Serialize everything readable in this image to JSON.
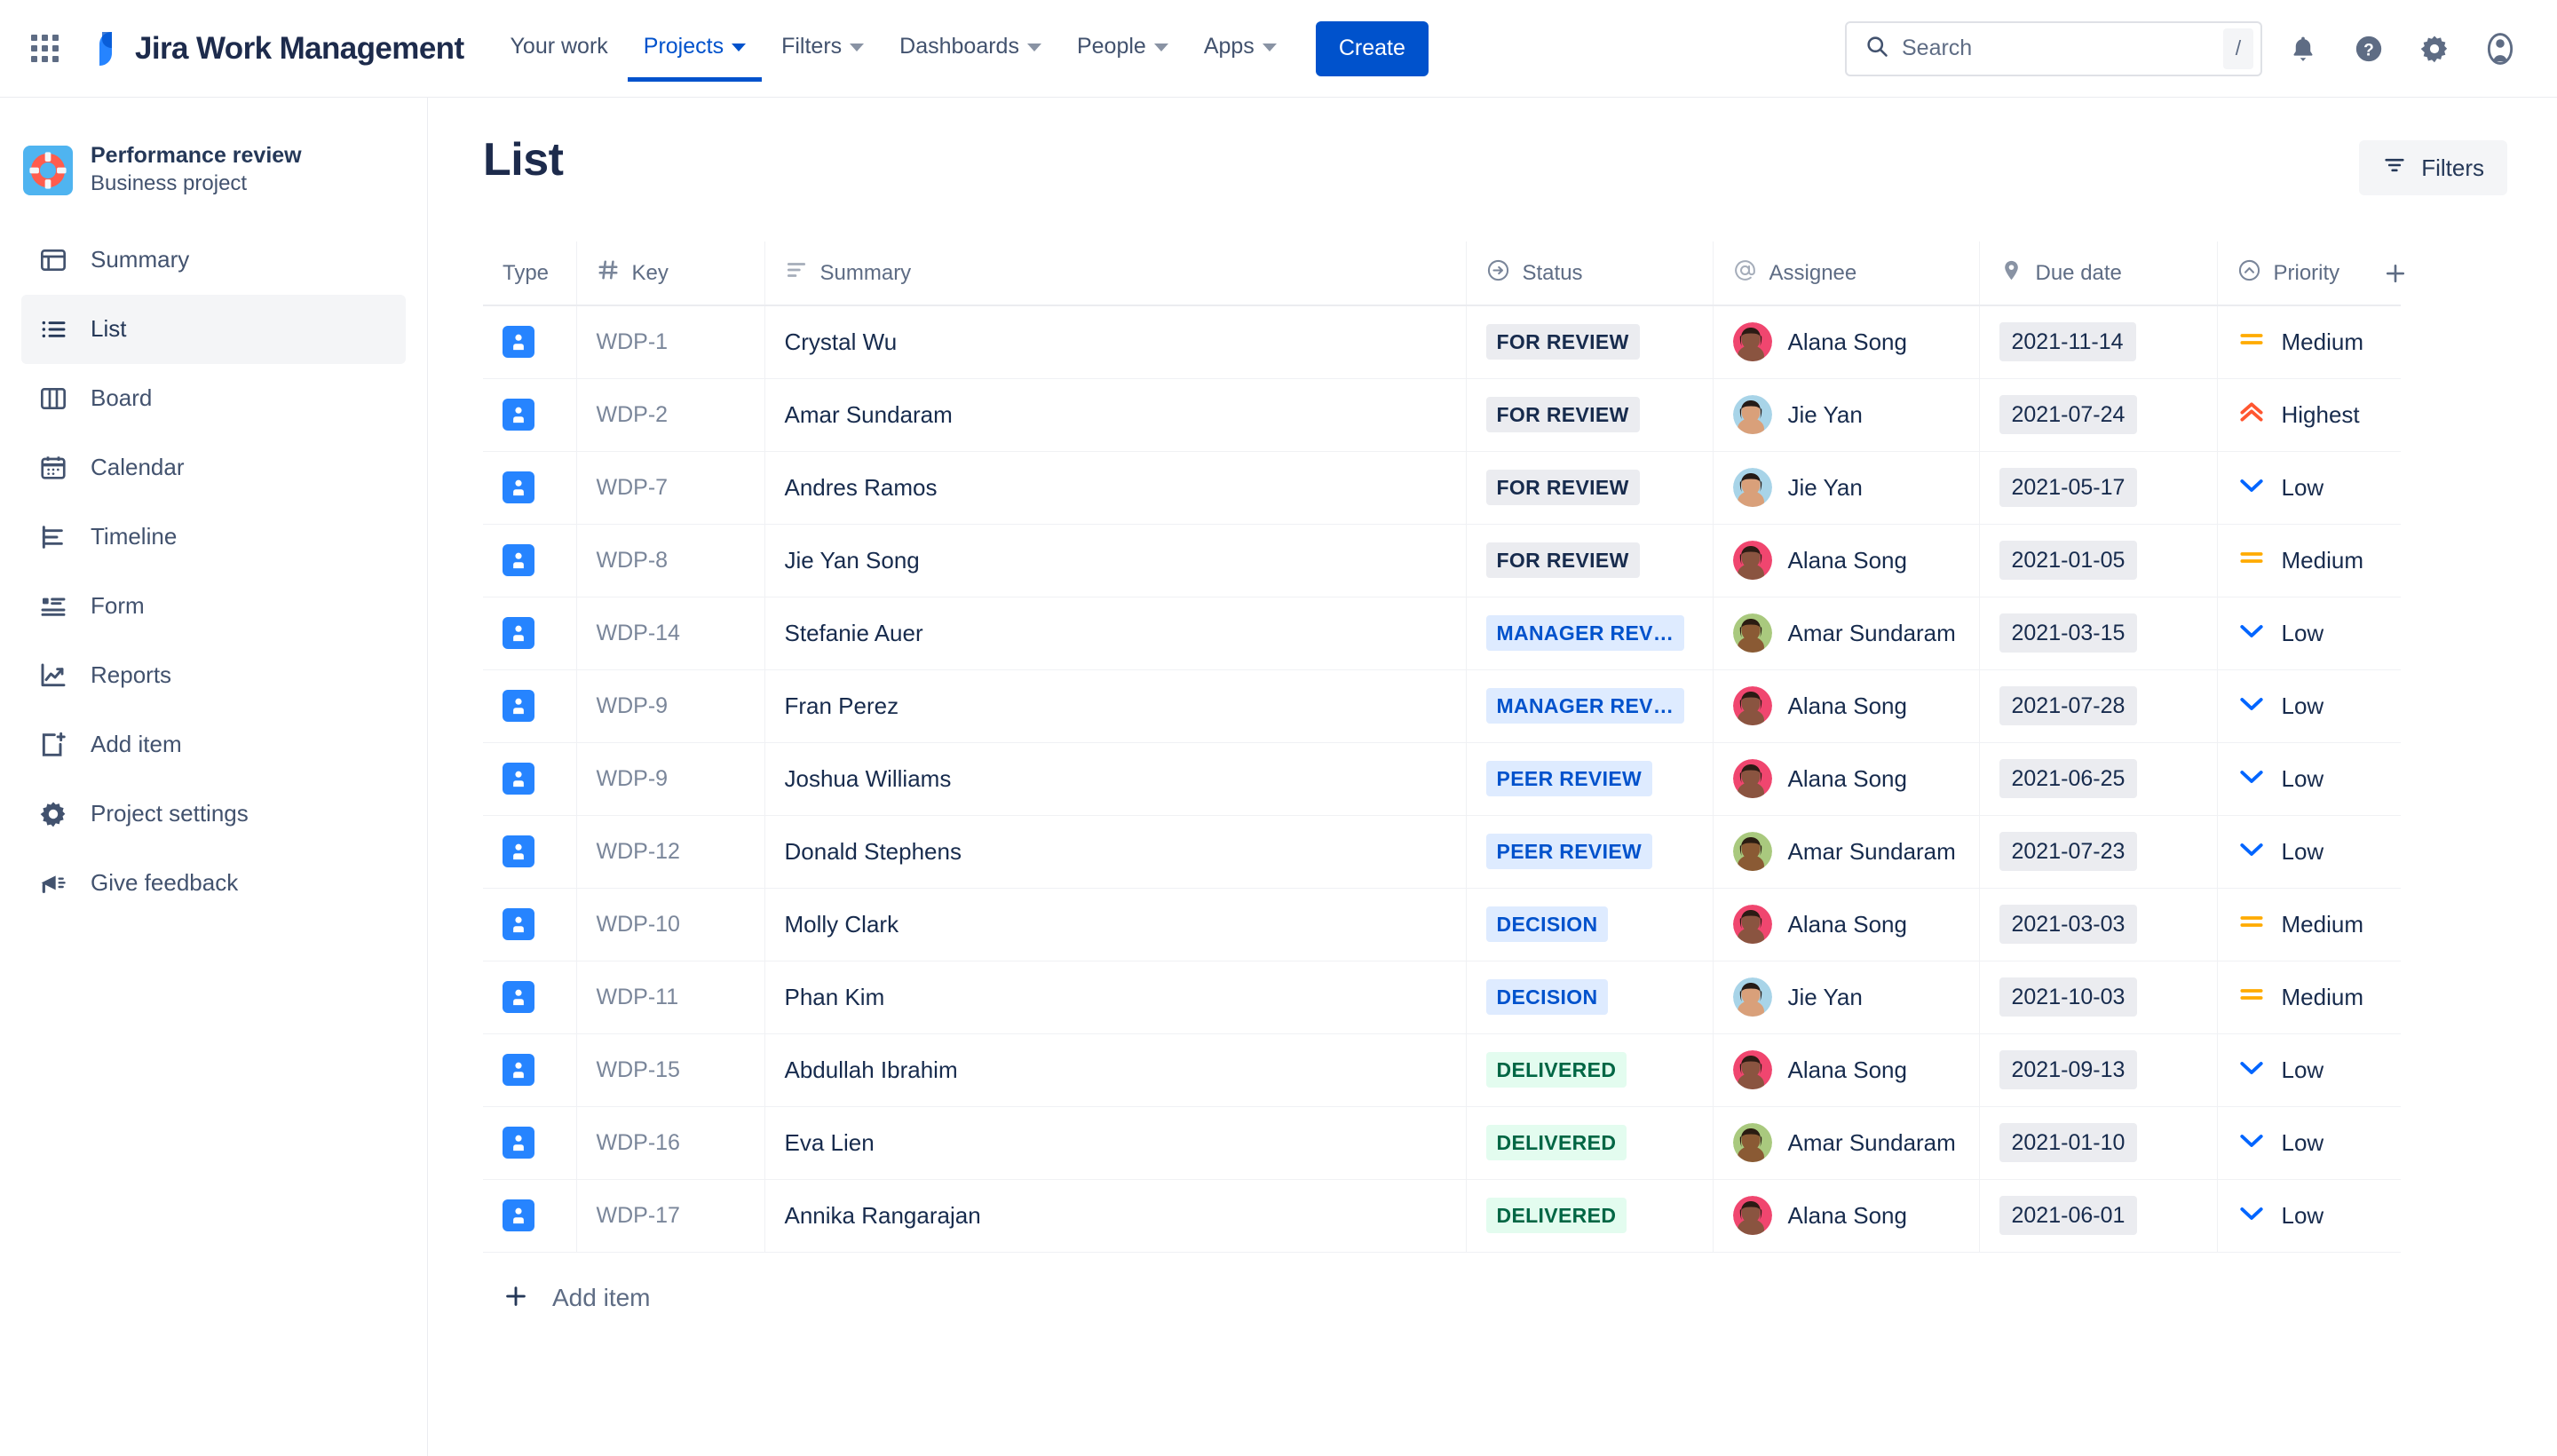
{
  "topnav": {
    "app_switcher_icon": "apps-grid-icon",
    "brand": "Jira Work Management",
    "items": [
      {
        "label": "Your work",
        "has_caret": false,
        "active": false
      },
      {
        "label": "Projects",
        "has_caret": true,
        "active": true
      },
      {
        "label": "Filters",
        "has_caret": true,
        "active": false
      },
      {
        "label": "Dashboards",
        "has_caret": true,
        "active": false
      },
      {
        "label": "People",
        "has_caret": true,
        "active": false
      },
      {
        "label": "Apps",
        "has_caret": true,
        "active": false
      }
    ],
    "create_label": "Create",
    "search": {
      "placeholder": "Search",
      "value": "",
      "shortcut": "/"
    },
    "icons": [
      "notifications-bell-icon",
      "help-icon",
      "settings-gear-icon",
      "user-profile-icon"
    ],
    "accent_color": "#0052CC"
  },
  "sidebar": {
    "project": {
      "name": "Performance review",
      "type": "Business project",
      "avatar_icon": "lifebuoy-icon",
      "avatar_color": "#4FB4F0"
    },
    "items": [
      {
        "label": "Summary",
        "icon": "summary-icon",
        "selected": false
      },
      {
        "label": "List",
        "icon": "list-icon",
        "selected": true
      },
      {
        "label": "Board",
        "icon": "board-icon",
        "selected": false
      },
      {
        "label": "Calendar",
        "icon": "calendar-icon",
        "selected": false
      },
      {
        "label": "Timeline",
        "icon": "timeline-icon",
        "selected": false
      },
      {
        "label": "Form",
        "icon": "form-icon",
        "selected": false
      },
      {
        "label": "Reports",
        "icon": "reports-icon",
        "selected": false
      },
      {
        "label": "Add item",
        "icon": "add-item-icon",
        "selected": false
      },
      {
        "label": "Project settings",
        "icon": "gear-icon",
        "selected": false
      },
      {
        "label": "Give feedback",
        "icon": "megaphone-icon",
        "selected": false
      }
    ]
  },
  "main": {
    "title": "List",
    "filters_button": {
      "label": "Filters",
      "icon": "filter-icon"
    },
    "add_item": {
      "label": "Add item",
      "icon": "plus-icon"
    },
    "add_column_icon": "plus-icon",
    "columns": [
      {
        "label": "Type",
        "icon": null
      },
      {
        "label": "Key",
        "icon": "hash-icon"
      },
      {
        "label": "Summary",
        "icon": "summary-lines-icon"
      },
      {
        "label": "Status",
        "icon": "status-arrow-icon"
      },
      {
        "label": "Assignee",
        "icon": "at-icon"
      },
      {
        "label": "Due date",
        "icon": "tag-icon"
      },
      {
        "label": "Priority",
        "icon": "priority-chevron-icon"
      }
    ],
    "rows": [
      {
        "type_icon": "person-task-icon",
        "key": "WDP-1",
        "summary": "Crystal Wu",
        "status": "FOR REVIEW",
        "status_tone": "gray",
        "assignee": "Alana Song",
        "avatar": "alana",
        "due_date": "2021-11-14",
        "priority": "Medium",
        "priority_icon": "medium-icon"
      },
      {
        "type_icon": "person-task-icon",
        "key": "WDP-2",
        "summary": "Amar Sundaram",
        "status": "FOR REVIEW",
        "status_tone": "gray",
        "assignee": "Jie Yan",
        "avatar": "jie",
        "due_date": "2021-07-24",
        "priority": "Highest",
        "priority_icon": "highest-icon"
      },
      {
        "type_icon": "person-task-icon",
        "key": "WDP-7",
        "summary": "Andres Ramos",
        "status": "FOR REVIEW",
        "status_tone": "gray",
        "assignee": "Jie Yan",
        "avatar": "jie",
        "due_date": "2021-05-17",
        "priority": "Low",
        "priority_icon": "low-icon"
      },
      {
        "type_icon": "person-task-icon",
        "key": "WDP-8",
        "summary": "Jie Yan Song",
        "status": "FOR REVIEW",
        "status_tone": "gray",
        "assignee": "Alana Song",
        "avatar": "alana",
        "due_date": "2021-01-05",
        "priority": "Medium",
        "priority_icon": "medium-icon"
      },
      {
        "type_icon": "person-task-icon",
        "key": "WDP-14",
        "summary": "Stefanie Auer",
        "status": "MANAGER REV…",
        "status_tone": "blue",
        "assignee": "Amar Sundaram",
        "avatar": "amar",
        "due_date": "2021-03-15",
        "priority": "Low",
        "priority_icon": "low-icon"
      },
      {
        "type_icon": "person-task-icon",
        "key": "WDP-9",
        "summary": "Fran Perez",
        "status": "MANAGER REV…",
        "status_tone": "blue",
        "assignee": "Alana Song",
        "avatar": "alana",
        "due_date": "2021-07-28",
        "priority": "Low",
        "priority_icon": "low-icon"
      },
      {
        "type_icon": "person-task-icon",
        "key": "WDP-9",
        "summary": "Joshua Williams",
        "status": "PEER REVIEW",
        "status_tone": "blue",
        "assignee": "Alana Song",
        "avatar": "alana",
        "due_date": "2021-06-25",
        "priority": "Low",
        "priority_icon": "low-icon"
      },
      {
        "type_icon": "person-task-icon",
        "key": "WDP-12",
        "summary": "Donald Stephens",
        "status": "PEER REVIEW",
        "status_tone": "blue",
        "assignee": "Amar Sundaram",
        "avatar": "amar",
        "due_date": "2021-07-23",
        "priority": "Low",
        "priority_icon": "low-icon"
      },
      {
        "type_icon": "person-task-icon",
        "key": "WDP-10",
        "summary": "Molly Clark",
        "status": "DECISION",
        "status_tone": "blue",
        "assignee": "Alana Song",
        "avatar": "alana",
        "due_date": "2021-03-03",
        "priority": "Medium",
        "priority_icon": "medium-icon"
      },
      {
        "type_icon": "person-task-icon",
        "key": "WDP-11",
        "summary": "Phan Kim",
        "status": "DECISION",
        "status_tone": "blue",
        "assignee": "Jie Yan",
        "avatar": "jie",
        "due_date": "2021-10-03",
        "priority": "Medium",
        "priority_icon": "medium-icon"
      },
      {
        "type_icon": "person-task-icon",
        "key": "WDP-15",
        "summary": "Abdullah Ibrahim",
        "status": "DELIVERED",
        "status_tone": "green",
        "assignee": "Alana Song",
        "avatar": "alana",
        "due_date": "2021-09-13",
        "priority": "Low",
        "priority_icon": "low-icon"
      },
      {
        "type_icon": "person-task-icon",
        "key": "WDP-16",
        "summary": "Eva Lien",
        "status": "DELIVERED",
        "status_tone": "green",
        "assignee": "Amar Sundaram",
        "avatar": "amar",
        "due_date": "2021-01-10",
        "priority": "Low",
        "priority_icon": "low-icon"
      },
      {
        "type_icon": "person-task-icon",
        "key": "WDP-17",
        "summary": "Annika Rangarajan",
        "status": "DELIVERED",
        "status_tone": "green",
        "assignee": "Alana Song",
        "avatar": "alana",
        "due_date": "2021-06-01",
        "priority": "Low",
        "priority_icon": "low-icon"
      }
    ]
  },
  "colors": {
    "accent": "#0052CC",
    "type_chip": "#2684FF",
    "status_gray_bg": "#EBECF0",
    "status_blue_bg": "#DEEBFF",
    "status_blue_fg": "#0052CC",
    "status_green_bg": "#E3FCEF",
    "status_green_fg": "#006644",
    "priority_medium": "#FFAB00",
    "priority_highest": "#FF5630",
    "priority_low": "#0065FF"
  }
}
